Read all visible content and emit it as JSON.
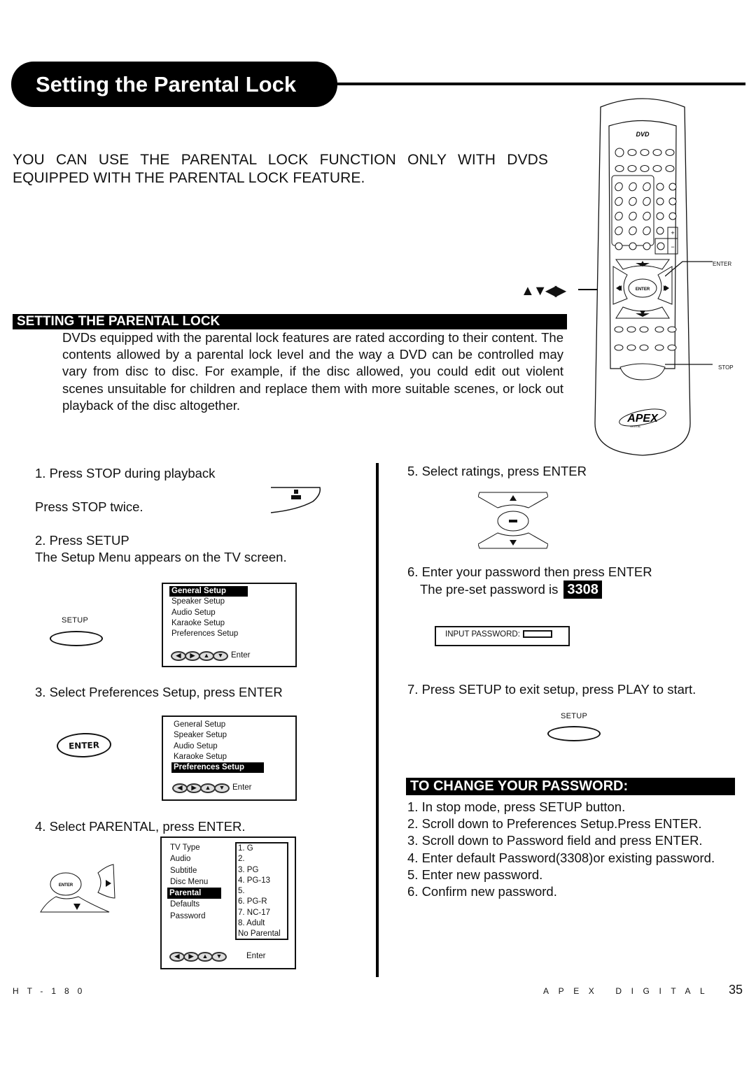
{
  "page": {
    "title": "Setting the Parental Lock",
    "intro_lines": [
      "YOU CAN USE THE PARENTAL LOCK FUNCTION ONLY WITH DVDS",
      "EQUIPPED WITH THE PARENTAL LOCK FEATURE."
    ],
    "nav_arrows_glyph": "▲▼◀▶",
    "section1": {
      "heading": "SETTING THE PARENTAL LOCK",
      "body": "DVDs equipped with the parental lock features are rated according to their content.  The contents allowed by a parental lock level and the way a DVD can be controlled may vary from disc to disc.  For example, if the disc allowed, you could edit out violent scenes unsuitable for children and replace them with more suitable scenes, or lock out playback of the disc altogether."
    },
    "remote": {
      "callout_enter": "ENTER",
      "callout_stop": "STOP",
      "enter_label": "ENTER",
      "brand": "APEX",
      "brand_sub": "DIGITAL",
      "logo": "DVD"
    },
    "steps_left": {
      "step1": "1. Press STOP during playback",
      "step1b": "Press STOP twice.",
      "step2": "2. Press SETUP",
      "step2b": "The Setup Menu appears on the TV screen.",
      "setup_button_label": "SETUP",
      "step3": "3. Select Preferences Setup, press ENTER",
      "enter_button_label": "ENTER",
      "step4": "4. Select PARENTAL, press ENTER."
    },
    "setup_menu": {
      "items": [
        "General Setup",
        "Speaker Setup",
        "Audio Setup",
        "Karaoke Setup",
        "Preferences Setup"
      ],
      "footer_label": "Enter",
      "nav_glyphs": [
        "◀",
        "▶",
        "▲",
        "▼"
      ]
    },
    "preferences_menu": {
      "items": [
        "TV Type",
        "Audio",
        "Subtitle",
        "Disc Menu",
        "Parental",
        "Defaults",
        "Password"
      ],
      "selected": "Parental",
      "ratings": [
        "1. G",
        "2.",
        "3. PG",
        "4. PG-13",
        "5.",
        "6. PG-R",
        "7. NC-17",
        "8. Adult",
        "No Parental"
      ],
      "footer_label": "Enter"
    },
    "steps_right": {
      "step5": "5. Select ratings, press ENTER",
      "step6": "6. Enter your password then press ENTER",
      "step6b": "The pre-set password is",
      "preset_password": "3308",
      "input_password_label": "INPUT PASSWORD:",
      "step7": "7. Press SETUP to exit setup, press PLAY to start.",
      "setup_button_label": "SETUP"
    },
    "section2": {
      "heading": "TO CHANGE YOUR PASSWORD:",
      "items": [
        "1. In stop mode, press SETUP button.",
        "2. Scroll down to Preferences Setup.Press ENTER.",
        "3. Scroll down to Password field and press ENTER.",
        "4. Enter default Password(3308)or existing password.",
        "5. Enter new password.",
        "6. Confirm new password."
      ]
    },
    "footer": {
      "model": "HT-180",
      "brand": "APEX DIGITAL",
      "page_number": "35"
    }
  }
}
